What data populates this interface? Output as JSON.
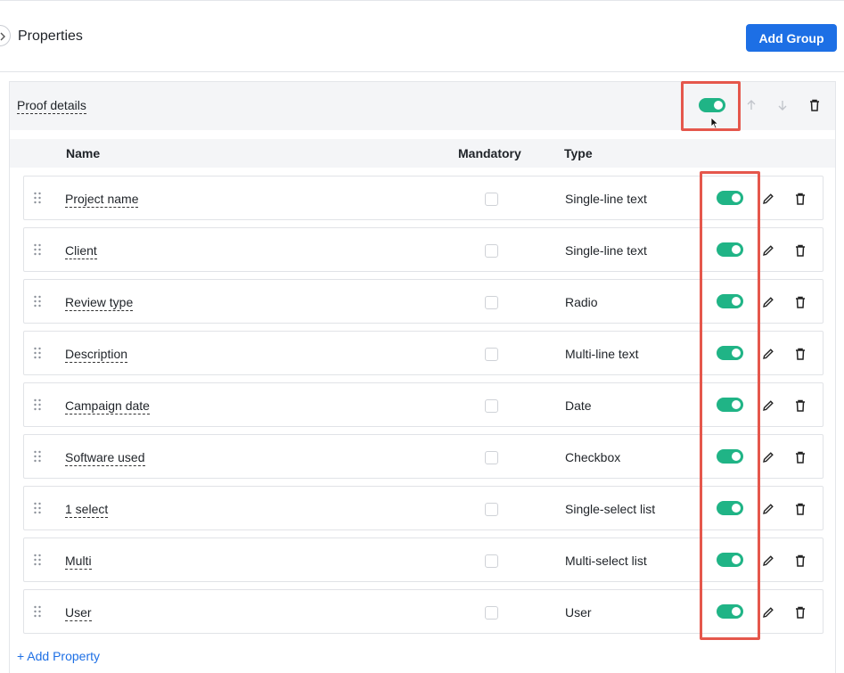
{
  "header": {
    "title": "Properties",
    "add_group_label": "Add Group"
  },
  "group": {
    "name": "Proof details",
    "visible_on": true
  },
  "columns": {
    "name": "Name",
    "mandatory": "Mandatory",
    "type": "Type"
  },
  "rows": [
    {
      "name": "Project name",
      "mandatory": false,
      "type": "Single-line text",
      "enabled": true
    },
    {
      "name": "Client",
      "mandatory": false,
      "type": "Single-line text",
      "enabled": true
    },
    {
      "name": "Review type",
      "mandatory": false,
      "type": "Radio",
      "enabled": true
    },
    {
      "name": "Description",
      "mandatory": false,
      "type": "Multi-line text",
      "enabled": true
    },
    {
      "name": "Campaign date",
      "mandatory": false,
      "type": "Date",
      "enabled": true
    },
    {
      "name": "Software used",
      "mandatory": false,
      "type": "Checkbox",
      "enabled": true
    },
    {
      "name": "1 select",
      "mandatory": false,
      "type": "Single-select list",
      "enabled": true
    },
    {
      "name": "Multi",
      "mandatory": false,
      "type": "Multi-select list",
      "enabled": true
    },
    {
      "name": "User",
      "mandatory": false,
      "type": "User",
      "enabled": true
    }
  ],
  "add_property_label": "+ Add Property",
  "colors": {
    "accent": "#1d6fe5",
    "toggle_on": "#20b486",
    "highlight": "#e5574c"
  }
}
